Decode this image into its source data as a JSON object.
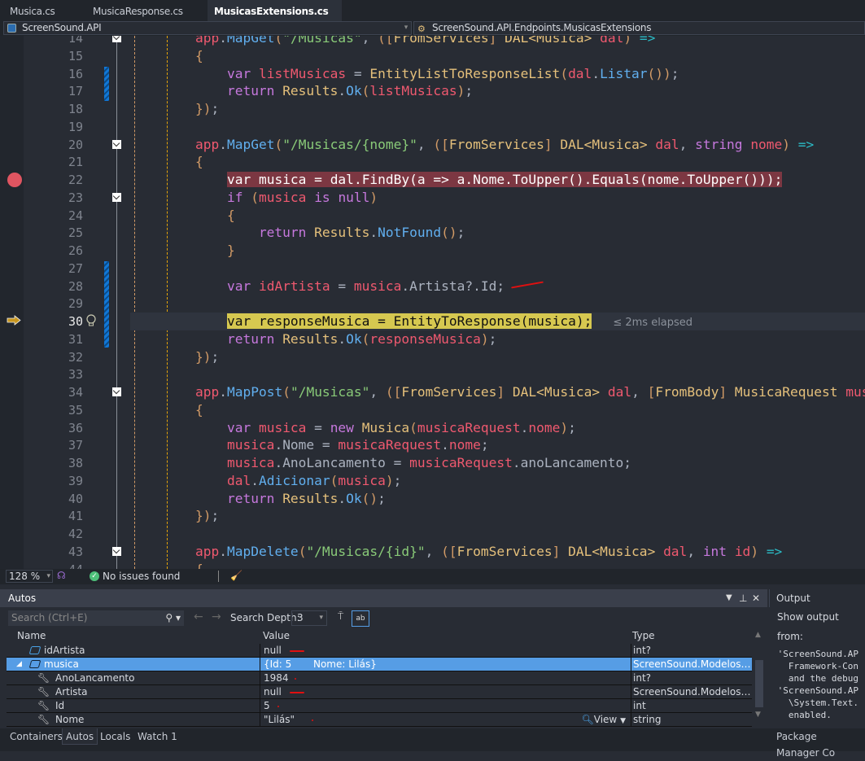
{
  "tabs": [
    {
      "label": "Musica.cs"
    },
    {
      "label": "MusicaResponse.cs"
    },
    {
      "label": "MusicasExtensions.cs",
      "active": true
    }
  ],
  "tab_pin": "⊹",
  "tab_close": "X",
  "nav": {
    "project": "ScreenSound.API",
    "member": "ScreenSound.API.Endpoints.MusicasExtensions"
  },
  "editor": {
    "first_line": 14,
    "breakpoint_line": 22,
    "current_line": 30,
    "elapsed": "≤ 2ms elapsed",
    "lines": [
      "        app.MapGet(\"/Musicas\", ([FromServices] DAL<Musica> dal) =>",
      "        {",
      "            var listMusicas = EntityListToResponseList(dal.Listar());",
      "            return Results.Ok(listMusicas);",
      "        });",
      "",
      "        app.MapGet(\"/Musicas/{nome}\", ([FromServices] DAL<Musica> dal, string nome) =>",
      "        {",
      "            var musica = dal.FindBy(a => a.Nome.ToUpper().Equals(nome.ToUpper()));",
      "            if (musica is null)",
      "            {",
      "                return Results.NotFound();",
      "            }",
      "",
      "            var idArtista = musica.Artista?.Id;",
      "",
      "            var responseMusica = EntityToResponse(musica);",
      "            return Results.Ok(responseMusica);",
      "        });",
      "",
      "        app.MapPost(\"/Musicas\", ([FromServices] DAL<Musica> dal, [FromBody] MusicaRequest musicaRequest) =>",
      "        {",
      "            var musica = new Musica(musicaRequest.nome);",
      "            musica.Nome = musicaRequest.nome;",
      "            musica.AnoLancamento = musicaRequest.anoLancamento;",
      "            dal.Adicionar(musica);",
      "            return Results.Ok();",
      "        });",
      "",
      "        app.MapDelete(\"/Musicas/{id}\", ([FromServices] DAL<Musica> dal, int id) =>",
      "        {"
    ]
  },
  "status": {
    "zoom": "128 %",
    "issues": "No issues found"
  },
  "autos": {
    "title": "Autos",
    "search_placeholder": "Search (Ctrl+E)",
    "depth_label": "Search Depth:",
    "depth_value": "3",
    "columns": {
      "name": "Name",
      "value": "Value",
      "type": "Type"
    },
    "rows": [
      {
        "name": "idArtista",
        "value": "null",
        "type": "int?",
        "level": 0,
        "icon": "local-variable-icon"
      },
      {
        "name": "musica",
        "value": "{Id: 5       Nome: Lilás}",
        "type": "ScreenSound.Modelos.M...",
        "level": 0,
        "icon": "local-variable-icon",
        "expanded": true,
        "selected": true
      },
      {
        "name": "AnoLancamento",
        "value": "1984",
        "type": "int?",
        "level": 1,
        "icon": "property-wrench-icon"
      },
      {
        "name": "Artista",
        "value": "null",
        "type": "ScreenSound.Modelos.Art...",
        "level": 1,
        "icon": "property-wrench-icon"
      },
      {
        "name": "Id",
        "value": "5",
        "type": "int",
        "level": 1,
        "icon": "property-wrench-icon"
      },
      {
        "name": "Nome",
        "value": "\"Lilás\"",
        "type": "string",
        "level": 1,
        "icon": "property-wrench-icon",
        "visualizer": "View"
      }
    ]
  },
  "output": {
    "title": "Output",
    "show_from": "Show output from:",
    "lines": [
      " 'ScreenSound.AP",
      "   Framework-Con",
      "   and the debug",
      " 'ScreenSound.AP",
      "   \\System.Text.",
      "   enabled."
    ]
  },
  "bottom_tabs": [
    {
      "label": "Containers"
    },
    {
      "label": "Autos",
      "active": true
    },
    {
      "label": "Locals"
    },
    {
      "label": "Watch 1"
    }
  ],
  "output_tab": "Package Manager Co",
  "colors": {
    "breakpoint": "#e05561",
    "current_line": "#d6c850",
    "selection": "#569de5"
  }
}
